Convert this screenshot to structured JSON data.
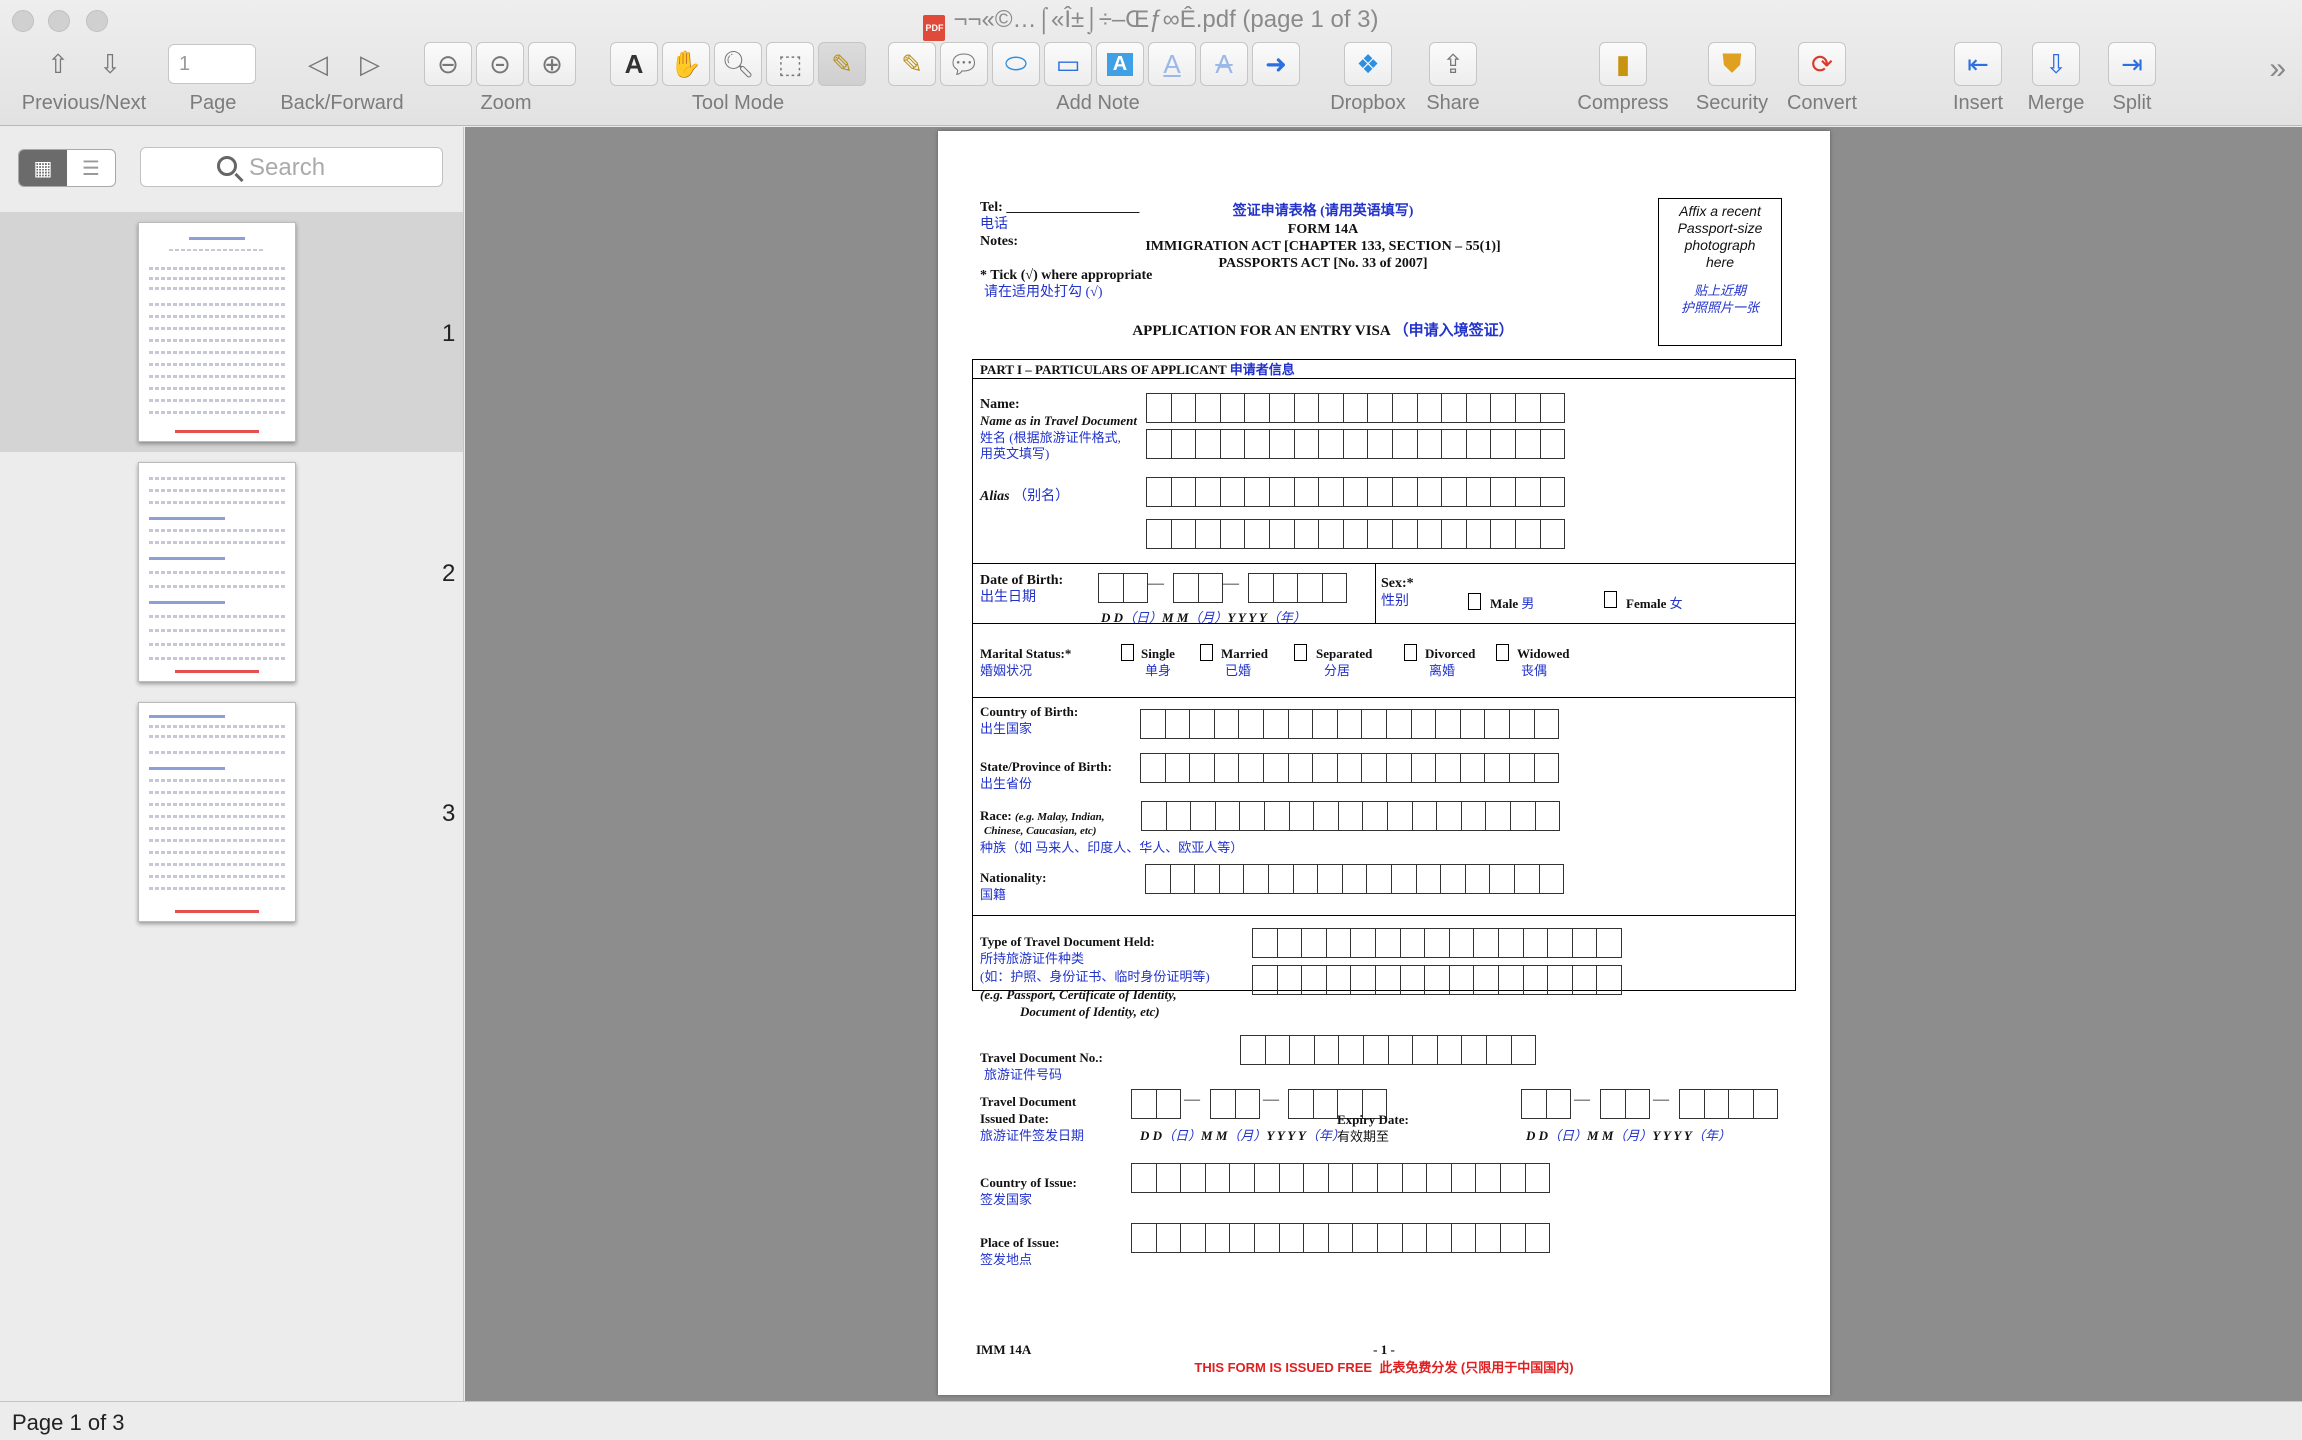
{
  "window": {
    "title": "¬¬«©…⌠«Î±⌡÷–Œƒ∞Ê.pdf (page 1 of 3)",
    "file_badge": "PDF"
  },
  "toolbar": {
    "prev_next": "Previous/Next",
    "page": "Page",
    "page_value": "1",
    "back_forward": "Back/Forward",
    "zoom": "Zoom",
    "tool_mode": "Tool Mode",
    "add_note": "Add Note",
    "dropbox": "Dropbox",
    "share": "Share",
    "compress": "Compress",
    "security": "Security",
    "convert": "Convert",
    "insert": "Insert",
    "merge": "Merge",
    "split": "Split",
    "overflow_icon": "chevron-double-right"
  },
  "sidebar": {
    "search_placeholder": "Search",
    "pages": [
      {
        "num": "1",
        "selected": true
      },
      {
        "num": "2",
        "selected": false
      },
      {
        "num": "3",
        "selected": false
      }
    ]
  },
  "document": {
    "tel_label": "Tel:",
    "tel_cn": "电话",
    "notes_label": "Notes:",
    "tick_note": "* Tick (√) where appropriate",
    "tick_note_cn": "请在适用处打勾 (√)",
    "title_cn": "签证申请表格 (请用英语填写)",
    "form_no": "FORM 14A",
    "act1": "IMMIGRATION ACT [CHAPTER 133, SECTION – 55(1)]",
    "act2": "PASSPORTS ACT [No. 33 of 2007]",
    "application": "APPLICATION FOR AN ENTRY VISA",
    "application_cn": "（申请入境签证）",
    "photo_en": [
      "Affix a recent",
      "Passport-size",
      "photograph",
      "here"
    ],
    "photo_cn": [
      "贴上近期",
      "护照照片一张"
    ],
    "part1": "PART I – PARTICULARS OF APPLICANT",
    "part1_cn": "申请者信息",
    "name_label": "Name:",
    "name_sub": "Name as in Travel Document",
    "name_cn1": "姓名 (根据旅游证件格式,",
    "name_cn2": "用英文填写)",
    "alias_label": "Alias",
    "alias_cn": "（别名）",
    "dob_label": "Date of Birth:",
    "dob_cn": "出生日期",
    "date_format": [
      "D D",
      "（日）",
      "M M",
      "（月）",
      "Y Y Y Y",
      "（年）"
    ],
    "sex_label": "Sex:*",
    "sex_cn": "性别",
    "male": "Male",
    "male_cn": "男",
    "female": "Female",
    "female_cn": "女",
    "marital_label": "Marital Status:*",
    "marital_cn": "婚姻状况",
    "marital_options": [
      {
        "en": "Single",
        "cn": "单身"
      },
      {
        "en": "Married",
        "cn": "已婚"
      },
      {
        "en": "Separated",
        "cn": "分居"
      },
      {
        "en": "Divorced",
        "cn": "离婚"
      },
      {
        "en": "Widowed",
        "cn": "丧偶"
      }
    ],
    "cob_label": "Country of Birth:",
    "cob_cn": "出生国家",
    "spob_label": "State/Province of Birth:",
    "spob_cn": "出生省份",
    "race_label": "Race:",
    "race_eg": "(e.g. Malay, Indian,",
    "race_eg2": "Chinese, Caucasian, etc)",
    "race_cn": "种族（如 马来人、印度人、华人、欧亚人等）",
    "nationality_label": "Nationality:",
    "nationality_cn": "国籍",
    "tdh_label": "Type of Travel Document Held:",
    "tdh_cn": "所持旅游证件种类",
    "tdh_cn2": "(如：护照、身份证书、临时身份证明等)",
    "tdh_eg": "(e.g.  Passport, Certificate of Identity,",
    "tdh_eg2": "Document of Identity, etc)",
    "tdn_label": "Travel Document No.:",
    "tdn_cn": "旅游证件号码",
    "tdi_label1": "Travel Document",
    "tdi_label2": "Issued Date:",
    "tdi_cn": "旅游证件签发日期",
    "expiry_label": "Expiry Date:",
    "expiry_cn": "有效期至",
    "coi_label": "Country of Issue:",
    "coi_cn": "签发国家",
    "poi_label": "Place of Issue:",
    "poi_cn": "签发地点",
    "footer_code": "IMM  14A",
    "page_no": "- 1 -",
    "free_notice": "THIS FORM IS ISSUED FREE",
    "free_notice_cn": "此表免费分发 (只限用于中国国内)"
  },
  "status": {
    "text": "Page 1 of 3"
  }
}
